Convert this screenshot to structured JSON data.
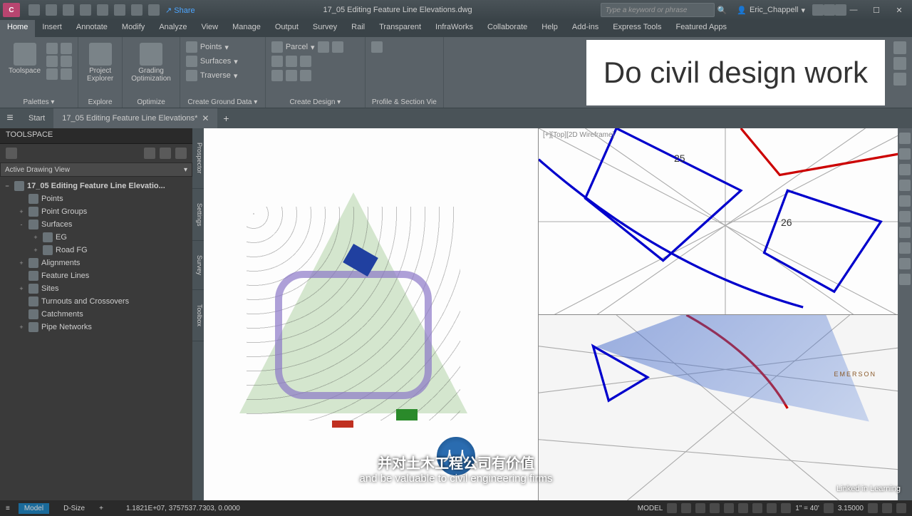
{
  "titlebar": {
    "logo": "C",
    "share": "Share",
    "filename": "17_05 Editing Feature Line Elevations.dwg",
    "search_placeholder": "Type a keyword or phrase",
    "username": "Eric_Chappell"
  },
  "ribbon": {
    "tabs": [
      "Home",
      "Insert",
      "Annotate",
      "Modify",
      "Analyze",
      "View",
      "Manage",
      "Output",
      "Survey",
      "Rail",
      "Transparent",
      "InfraWorks",
      "Collaborate",
      "Help",
      "Add-ins",
      "Express Tools",
      "Featured Apps"
    ],
    "active_tab": "Home",
    "panels": {
      "palettes": "Palettes",
      "toolspace": "Toolspace",
      "project_explorer": "Project\nExplorer",
      "explore": "Explore",
      "grading_opt": "Grading\nOptimization",
      "optimize": "Optimize",
      "points": "Points",
      "surfaces": "Surfaces",
      "traverse": "Traverse",
      "create_ground": "Create Ground Data",
      "parcel": "Parcel",
      "create_design": "Create Design",
      "profile_section": "Profile & Section Vie"
    },
    "overlay_text": "Do civil design work"
  },
  "doctabs": {
    "start": "Start",
    "active": "17_05 Editing Feature Line Elevations*"
  },
  "toolspace": {
    "title": "TOOLSPACE",
    "view_selector": "Active Drawing View",
    "sidetabs": [
      "Prospector",
      "Settings",
      "Survey",
      "Toolbox"
    ],
    "tree": {
      "root": "17_05 Editing Feature Line Elevatio...",
      "nodes": [
        {
          "label": "Points",
          "lvl": 1,
          "exp": ""
        },
        {
          "label": "Point Groups",
          "lvl": 1,
          "exp": "+"
        },
        {
          "label": "Surfaces",
          "lvl": 1,
          "exp": "-"
        },
        {
          "label": "EG",
          "lvl": 2,
          "exp": "+"
        },
        {
          "label": "Road FG",
          "lvl": 2,
          "exp": "+"
        },
        {
          "label": "Alignments",
          "lvl": 1,
          "exp": "+"
        },
        {
          "label": "Feature Lines",
          "lvl": 1,
          "exp": ""
        },
        {
          "label": "Sites",
          "lvl": 1,
          "exp": "+"
        },
        {
          "label": "Turnouts and Crossovers",
          "lvl": 1,
          "exp": ""
        },
        {
          "label": "Catchments",
          "lvl": 1,
          "exp": ""
        },
        {
          "label": "Pipe Networks",
          "lvl": 1,
          "exp": "+"
        }
      ]
    }
  },
  "viewports": {
    "tr_label": "[+][Top][2D Wireframe]",
    "lot25": "25",
    "lot26": "26",
    "emerson": "EMERSON"
  },
  "statusbar": {
    "model": "Model",
    "dsize": "D-Size",
    "coords": "1.1821E+07, 3757537.7303, 0.0000",
    "modeltxt": "MODEL",
    "scale": "1\" = 40'",
    "decimal": "3.15000"
  },
  "subtitle": {
    "cn": "并对土木工程公司有价值",
    "en": "and be valuable to civil engineering firms"
  },
  "linkedin": "Linked in Learning"
}
